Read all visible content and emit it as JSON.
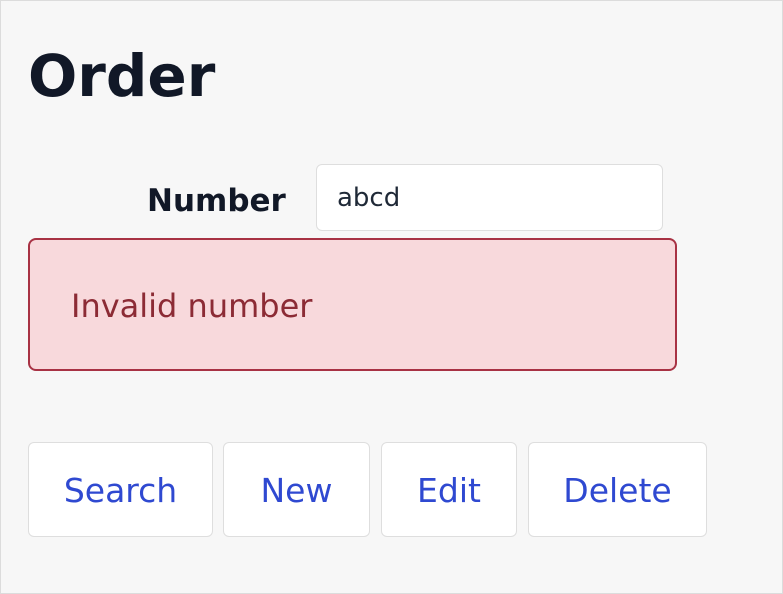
{
  "page": {
    "title": "Order"
  },
  "form": {
    "number_label": "Number",
    "number_value": "abcd",
    "error_message": "Invalid number"
  },
  "actions": {
    "search_label": "Search",
    "new_label": "New",
    "edit_label": "Edit",
    "delete_label": "Delete"
  },
  "colors": {
    "background": "#f7f7f7",
    "title_text": "#111827",
    "error_border": "#a83244",
    "error_background": "#f8d9dc",
    "error_text": "#8c2b35",
    "button_text": "#2f49d1"
  }
}
